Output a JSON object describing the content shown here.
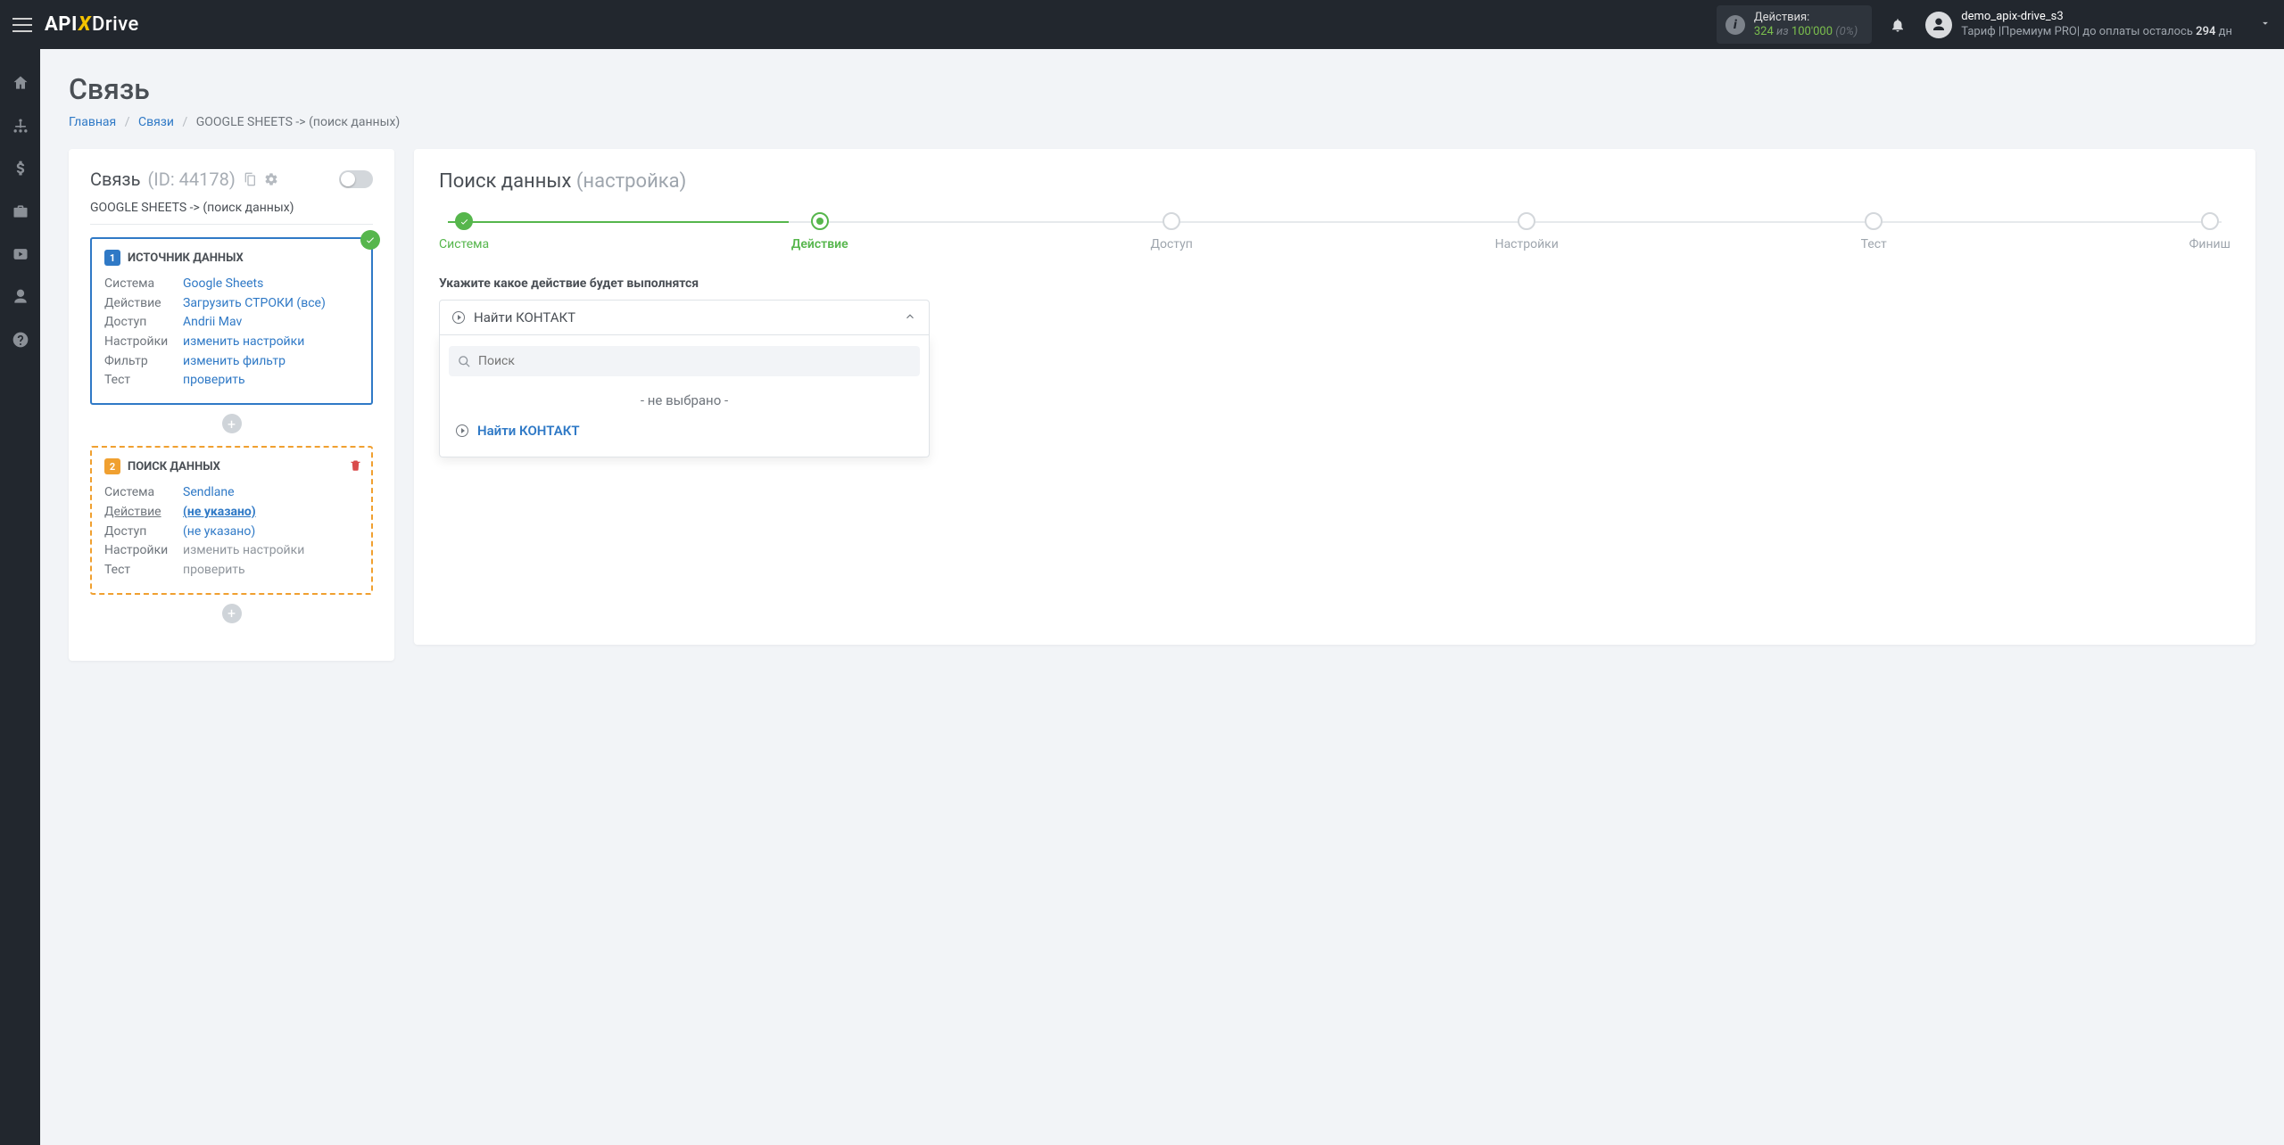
{
  "header": {
    "actions_label": "Действия:",
    "actions_used": "324",
    "actions_of_word": "из",
    "actions_total": "100'000",
    "actions_pct": "(0%)",
    "user_name": "demo_apix-drive_s3",
    "tariff_prefix": "Тариф |Премиум PRO| до оплаты осталось ",
    "tariff_days": "294",
    "tariff_days_suffix": " дн"
  },
  "page": {
    "title": "Связь",
    "breadcrumb": {
      "home": "Главная",
      "links": "Связи",
      "current": "GOOGLE SHEETS -> (поиск данных)"
    }
  },
  "left": {
    "title": "Связь",
    "id": "(ID: 44178)",
    "subtitle": "GOOGLE SHEETS -> (поиск данных)",
    "source": {
      "badge_num": "1",
      "badge_label": "ИСТОЧНИК ДАННЫХ",
      "rows": {
        "system_k": "Система",
        "system_v": "Google Sheets",
        "action_k": "Действие",
        "action_v": "Загрузить СТРОКИ (все)",
        "access_k": "Доступ",
        "access_v": "Andrii Mav",
        "settings_k": "Настройки",
        "settings_v": "изменить настройки",
        "filter_k": "Фильтр",
        "filter_v": "изменить фильтр",
        "test_k": "Тест",
        "test_v": "проверить"
      }
    },
    "search": {
      "badge_num": "2",
      "badge_label": "ПОИСК ДАННЫХ",
      "rows": {
        "system_k": "Система",
        "system_v": "Sendlane",
        "action_k": "Действие",
        "action_v": "(не указано)",
        "access_k": "Доступ",
        "access_v": "(не указано)",
        "settings_k": "Настройки",
        "settings_v": "изменить настройки",
        "test_k": "Тест",
        "test_v": "проверить"
      }
    }
  },
  "right": {
    "title_main": "Поиск данных",
    "title_sub": "(настройка)",
    "steps": [
      "Система",
      "Действие",
      "Доступ",
      "Настройки",
      "Тест",
      "Финиш"
    ],
    "field_label": "Укажите какое действие будет выполнятся",
    "selected_value": "Найти КОНТАКТ",
    "search_placeholder": "Поиск",
    "option_none": "- не выбрано -",
    "option_find_contact": "Найти КОНТАКТ"
  }
}
